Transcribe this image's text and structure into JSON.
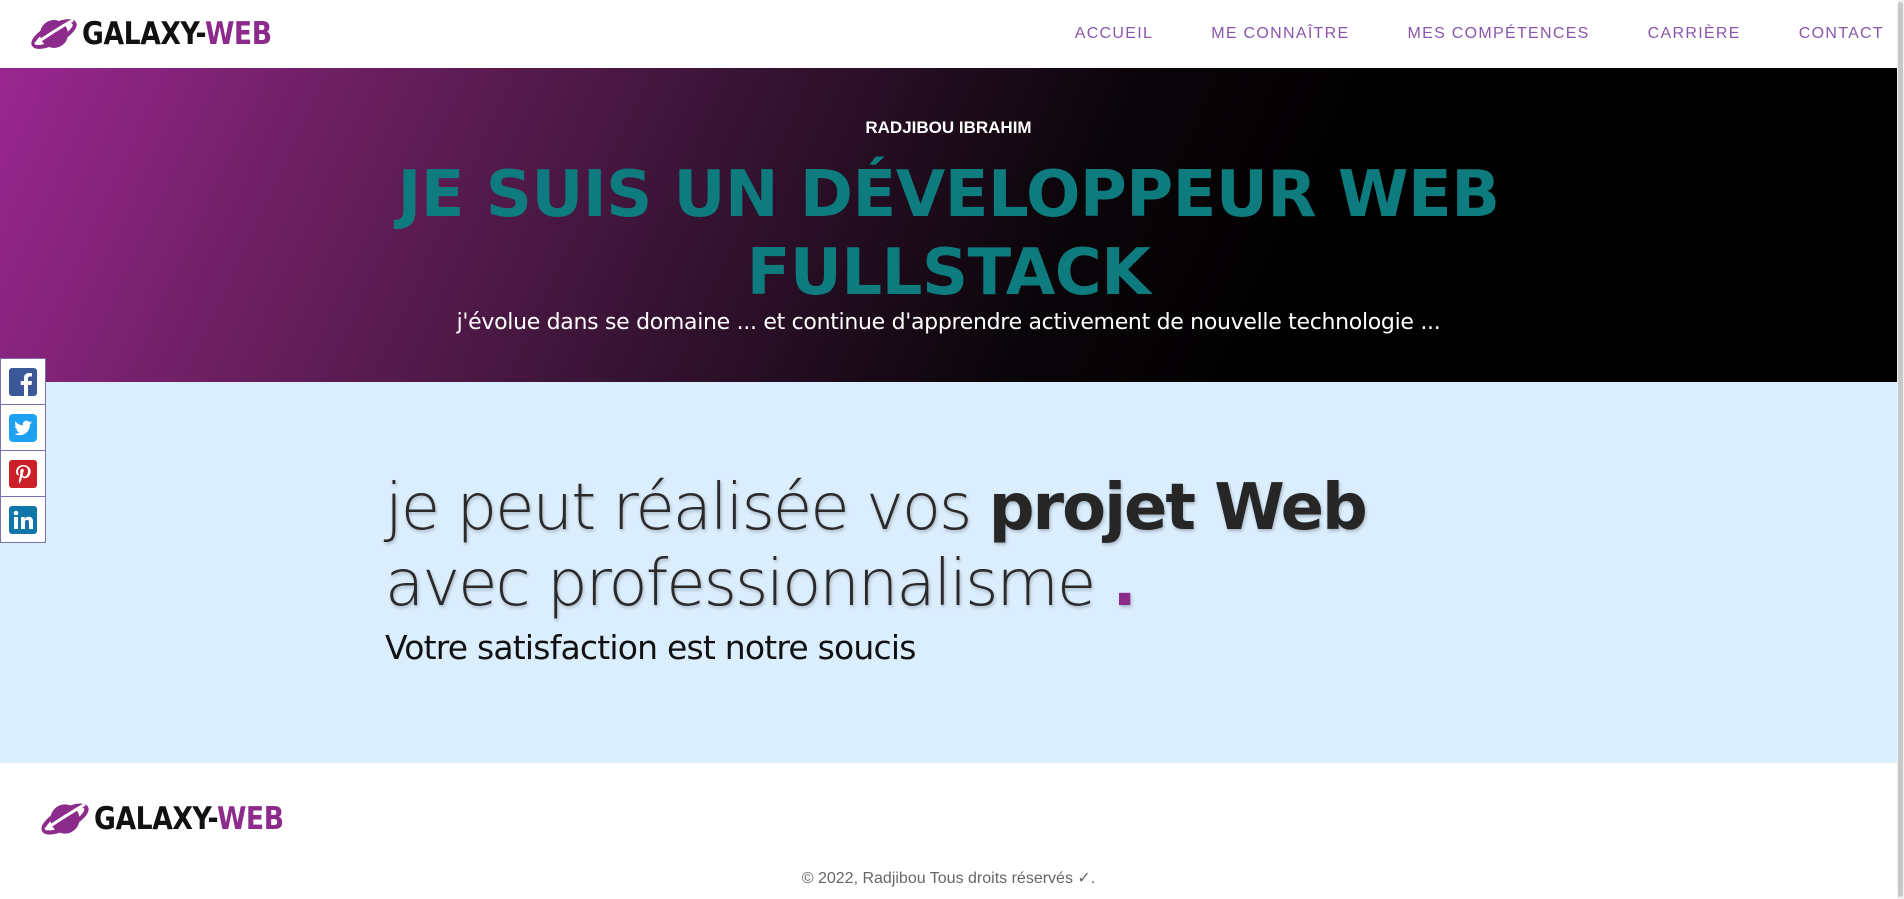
{
  "header": {
    "brand_part1": "GALAXY-",
    "brand_part2": "WEB",
    "nav": [
      "ACCUEIL",
      "ME CONNAÎTRE",
      "MES COMPÉTENCES",
      "CARRIÈRE",
      "CONTACT"
    ]
  },
  "hero": {
    "name": "RADJIBOU IBRAHIM",
    "title": "JE SUIS UN DÉVELOPPEUR WEB FULLSTACK",
    "subtitle": "j'évolue dans se domaine ... et continue d'apprendre activement de nouvelle technologie ..."
  },
  "main": {
    "headline_start": "je peut réalisée vos ",
    "headline_bold": "projet Web",
    "headline_end": " avec professionnalisme ",
    "headline_dot": ".",
    "tagline": "Votre satisfaction est notre soucis"
  },
  "social": [
    {
      "icon": "facebook-icon",
      "color": "#3b5998"
    },
    {
      "icon": "twitter-icon",
      "color": "#1da1f2"
    },
    {
      "icon": "pinterest-icon",
      "color": "#cb2027"
    },
    {
      "icon": "linkedin-icon",
      "color": "#0e76a8"
    }
  ],
  "footer": {
    "brand_part1": "GALAXY-",
    "brand_part2": "WEB",
    "copyright": "© 2022, Radjibou Tous droits réservés ✓."
  },
  "colors": {
    "brand": "#8c2b8c",
    "nav": "#8a56ac",
    "hero_title": "#0e7c7e",
    "main_bg": "#dbeefe"
  }
}
